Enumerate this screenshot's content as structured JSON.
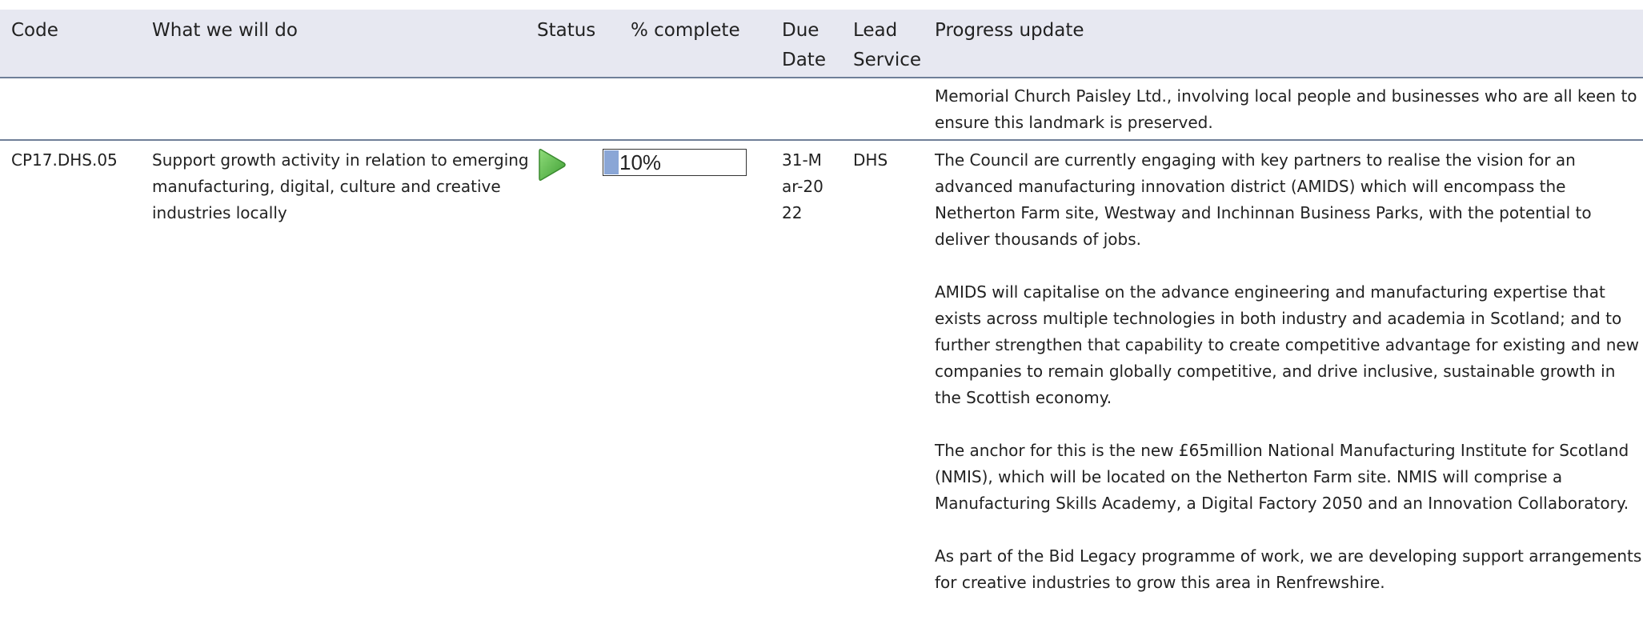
{
  "table": {
    "headers": {
      "code": "Code",
      "what": "What we will do",
      "status": "Status",
      "percent": "% complete",
      "due_date": "Due Date",
      "lead_service": "Lead Service",
      "progress": "Progress update"
    },
    "carry_over_text": "Memorial Church Paisley Ltd., involving local people and businesses who are all keen to ensure this landmark is preserved.",
    "rows": [
      {
        "code": "CP17.DHS.05",
        "what": "Support growth activity in relation to emerging manufacturing, digital, culture and creative industries locally",
        "status_icon": "green-play-icon",
        "status_color": "#5cb85c",
        "percent_complete": 10,
        "percent_label": "10%",
        "due_date": "31-Mar-2022",
        "lead_service": "DHS",
        "progress_paragraphs": [
          "The Council are currently engaging with key partners to realise the vision for an advanced manufacturing innovation district (AMIDS) which will encompass the Netherton Farm site, Westway and Inchinnan Business Parks, with the potential to deliver thousands of jobs.",
          "AMIDS will capitalise on the advance engineering and manufacturing expertise that exists across multiple technologies in both industry and academia in Scotland; and to further strengthen that capability to create competitive advantage for existing and new companies to remain globally competitive, and drive inclusive, sustainable growth in the Scottish economy.",
          "The anchor for this is the new £65million National Manufacturing Institute for Scotland (NMIS), which will be located on the Netherton Farm site. NMIS will comprise a Manufacturing Skills Academy, a Digital Factory 2050 and an Innovation Collaboratory.",
          "As part of the Bid Legacy programme of work, we are developing support arrangements for creative industries to grow this area in Renfrewshire."
        ]
      }
    ]
  }
}
